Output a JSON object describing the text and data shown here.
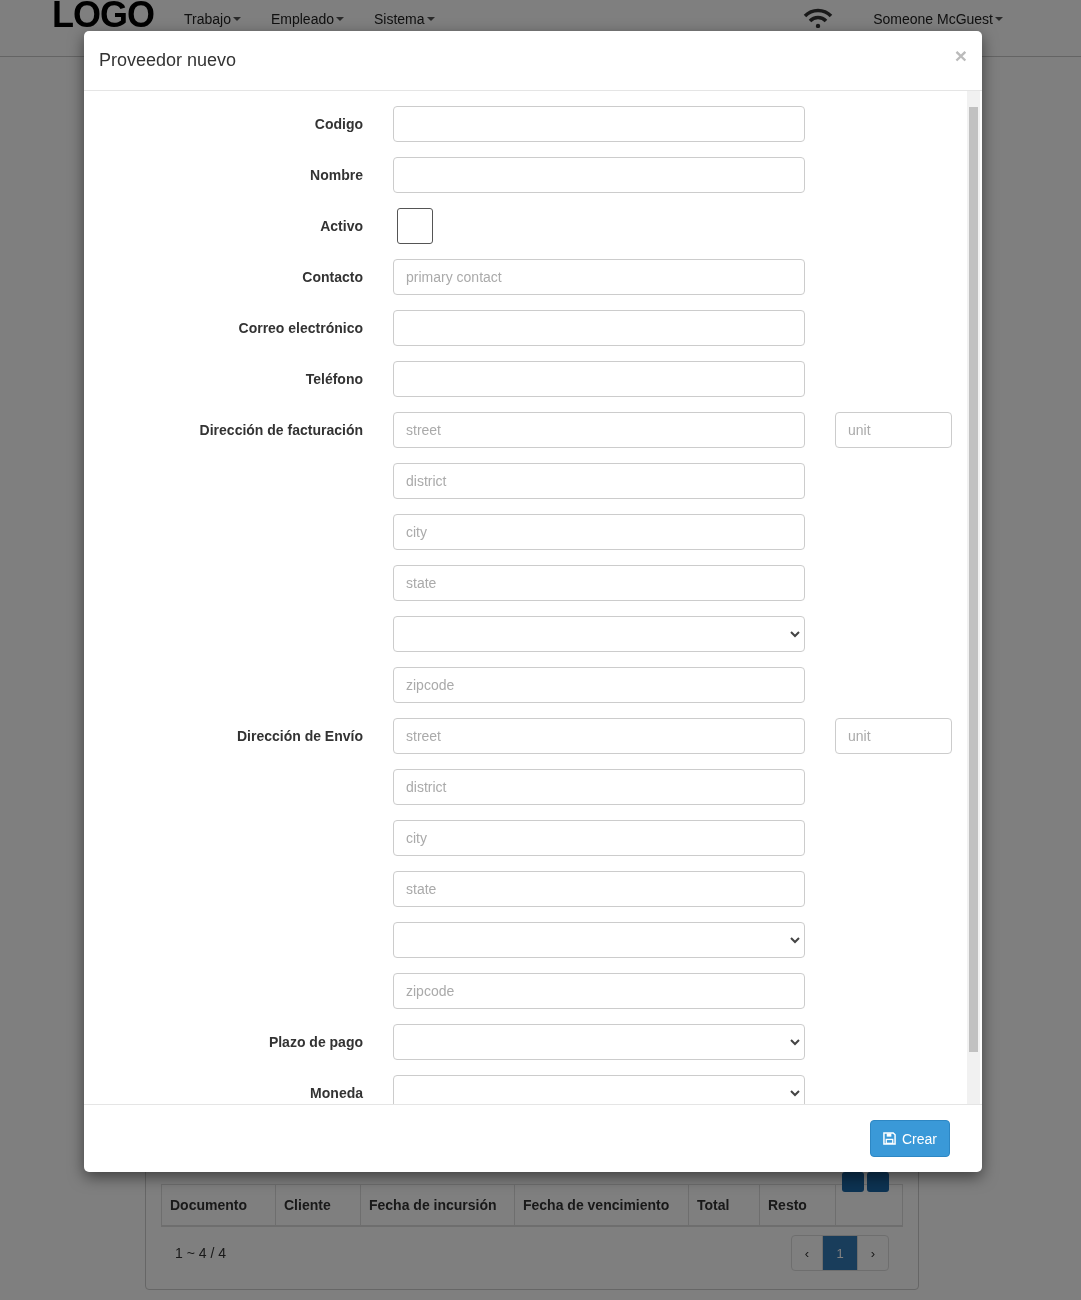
{
  "navbar": {
    "logo": "LOGO",
    "menus": [
      {
        "label": "Trabajo"
      },
      {
        "label": "Empleado"
      },
      {
        "label": "Sistema"
      }
    ],
    "user": "Someone McGuest"
  },
  "background_panel": {
    "table": {
      "columns": [
        "Documento",
        "Cliente",
        "Fecha de incursión",
        "Fecha de vencimiento",
        "Total",
        "Resto"
      ]
    },
    "range": "1 ~ 4 / 4",
    "pages": [
      {
        "label": "‹",
        "selected": false
      },
      {
        "label": "1",
        "selected": true
      },
      {
        "label": "›",
        "selected": false
      }
    ]
  },
  "modal": {
    "title": "Proveedor nuevo",
    "close": "×",
    "rows": [
      {
        "label": "Codigo",
        "kind": "text"
      },
      {
        "label": "Nombre",
        "kind": "text"
      },
      {
        "label": "Activo",
        "kind": "checkbox",
        "checked": false
      },
      {
        "label": "Contacto",
        "kind": "text",
        "placeholder": "primary contact"
      },
      {
        "label": "Correo electrónico",
        "kind": "text"
      },
      {
        "label": "Teléfono",
        "kind": "text"
      },
      {
        "label": "Dirección de facturación",
        "kind": "text",
        "placeholder": "street",
        "side": {
          "placeholder": "unit"
        }
      },
      {
        "kind": "text",
        "placeholder": "district"
      },
      {
        "kind": "text",
        "placeholder": "city"
      },
      {
        "kind": "text",
        "placeholder": "state"
      },
      {
        "kind": "select"
      },
      {
        "kind": "text",
        "placeholder": "zipcode"
      },
      {
        "label": "Dirección de Envío",
        "kind": "text",
        "placeholder": "street",
        "side": {
          "placeholder": "unit"
        }
      },
      {
        "kind": "text",
        "placeholder": "district"
      },
      {
        "kind": "text",
        "placeholder": "city"
      },
      {
        "kind": "text",
        "placeholder": "state"
      },
      {
        "kind": "select"
      },
      {
        "kind": "text",
        "placeholder": "zipcode"
      },
      {
        "label": "Plazo de pago",
        "kind": "select"
      },
      {
        "label": "Moneda",
        "kind": "select"
      }
    ],
    "button": "Crear"
  }
}
